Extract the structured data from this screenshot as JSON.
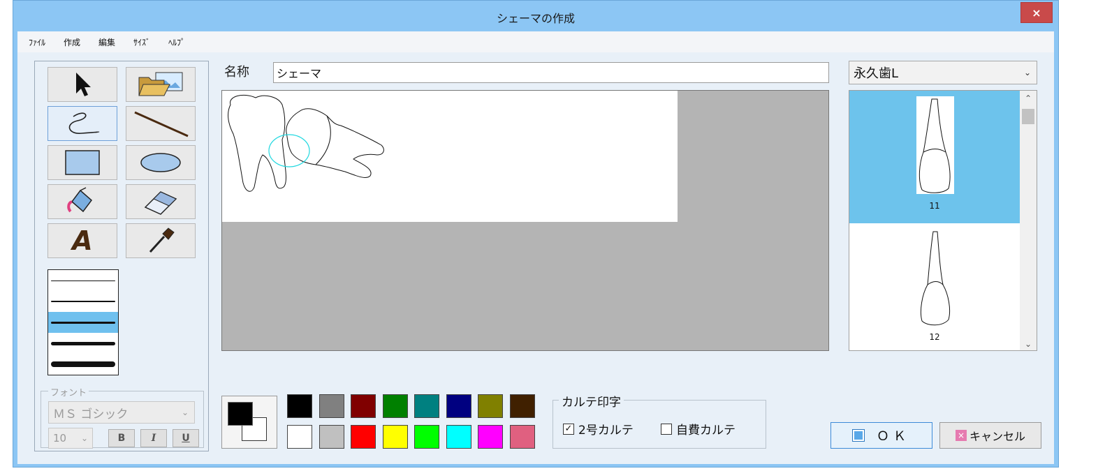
{
  "window": {
    "title": "シェーマの作成",
    "close_label": "×"
  },
  "menu": [
    "ﾌｧｲﾙ",
    "作成",
    "編集",
    "ｻｲｽﾞ",
    "ﾍﾙﾌﾟ"
  ],
  "toolbox": {
    "tools": [
      {
        "name": "select-tool",
        "icon": "arrow-pointer-icon"
      },
      {
        "name": "open-image-tool",
        "icon": "folder-image-icon"
      },
      {
        "name": "freehand-tool",
        "icon": "freehand-icon",
        "selected": true
      },
      {
        "name": "line-tool",
        "icon": "line-icon"
      },
      {
        "name": "rectangle-tool",
        "icon": "rectangle-icon"
      },
      {
        "name": "ellipse-tool",
        "icon": "ellipse-icon"
      },
      {
        "name": "fill-tool",
        "icon": "paint-bucket-icon"
      },
      {
        "name": "eraser-tool",
        "icon": "eraser-icon"
      },
      {
        "name": "text-tool",
        "icon": "text-a-icon"
      },
      {
        "name": "eyedropper-tool",
        "icon": "eyedropper-icon"
      }
    ],
    "text_tool_glyph": "A",
    "line_widths_selected_index": 2
  },
  "font": {
    "legend": "フォント",
    "family": "ＭＳ ゴシック",
    "size": "10",
    "bold": "B",
    "italic": "I",
    "underline": "U"
  },
  "name": {
    "label": "名称",
    "value": "シェーマ"
  },
  "palette": {
    "foreground": "#000000",
    "background": "#ffffff",
    "swatches": [
      "#000000",
      "#808080",
      "#800000",
      "#008000",
      "#008080",
      "#000080",
      "#808000",
      "#402000",
      "#ffffff",
      "#c0c0c0",
      "#ff0000",
      "#ffff00",
      "#00ff00",
      "#00ffff",
      "#ff00ff",
      "#e06080"
    ]
  },
  "karute": {
    "legend": "カルテ印字",
    "options": [
      {
        "label": "2号カルテ",
        "checked": true,
        "check_glyph": "✓"
      },
      {
        "label": "自費カルテ",
        "checked": false
      }
    ]
  },
  "tooth_type": {
    "value": "永久歯L"
  },
  "tooth_list": {
    "items": [
      {
        "label": "11",
        "selected": true
      },
      {
        "label": "12",
        "selected": false
      }
    ]
  },
  "buttons": {
    "ok": "ＯＫ",
    "cancel": "キャンセル",
    "cancel_icon": "×"
  },
  "colors": {
    "accent": "#6dc3ec",
    "window_frame": "#8cc6f4"
  }
}
